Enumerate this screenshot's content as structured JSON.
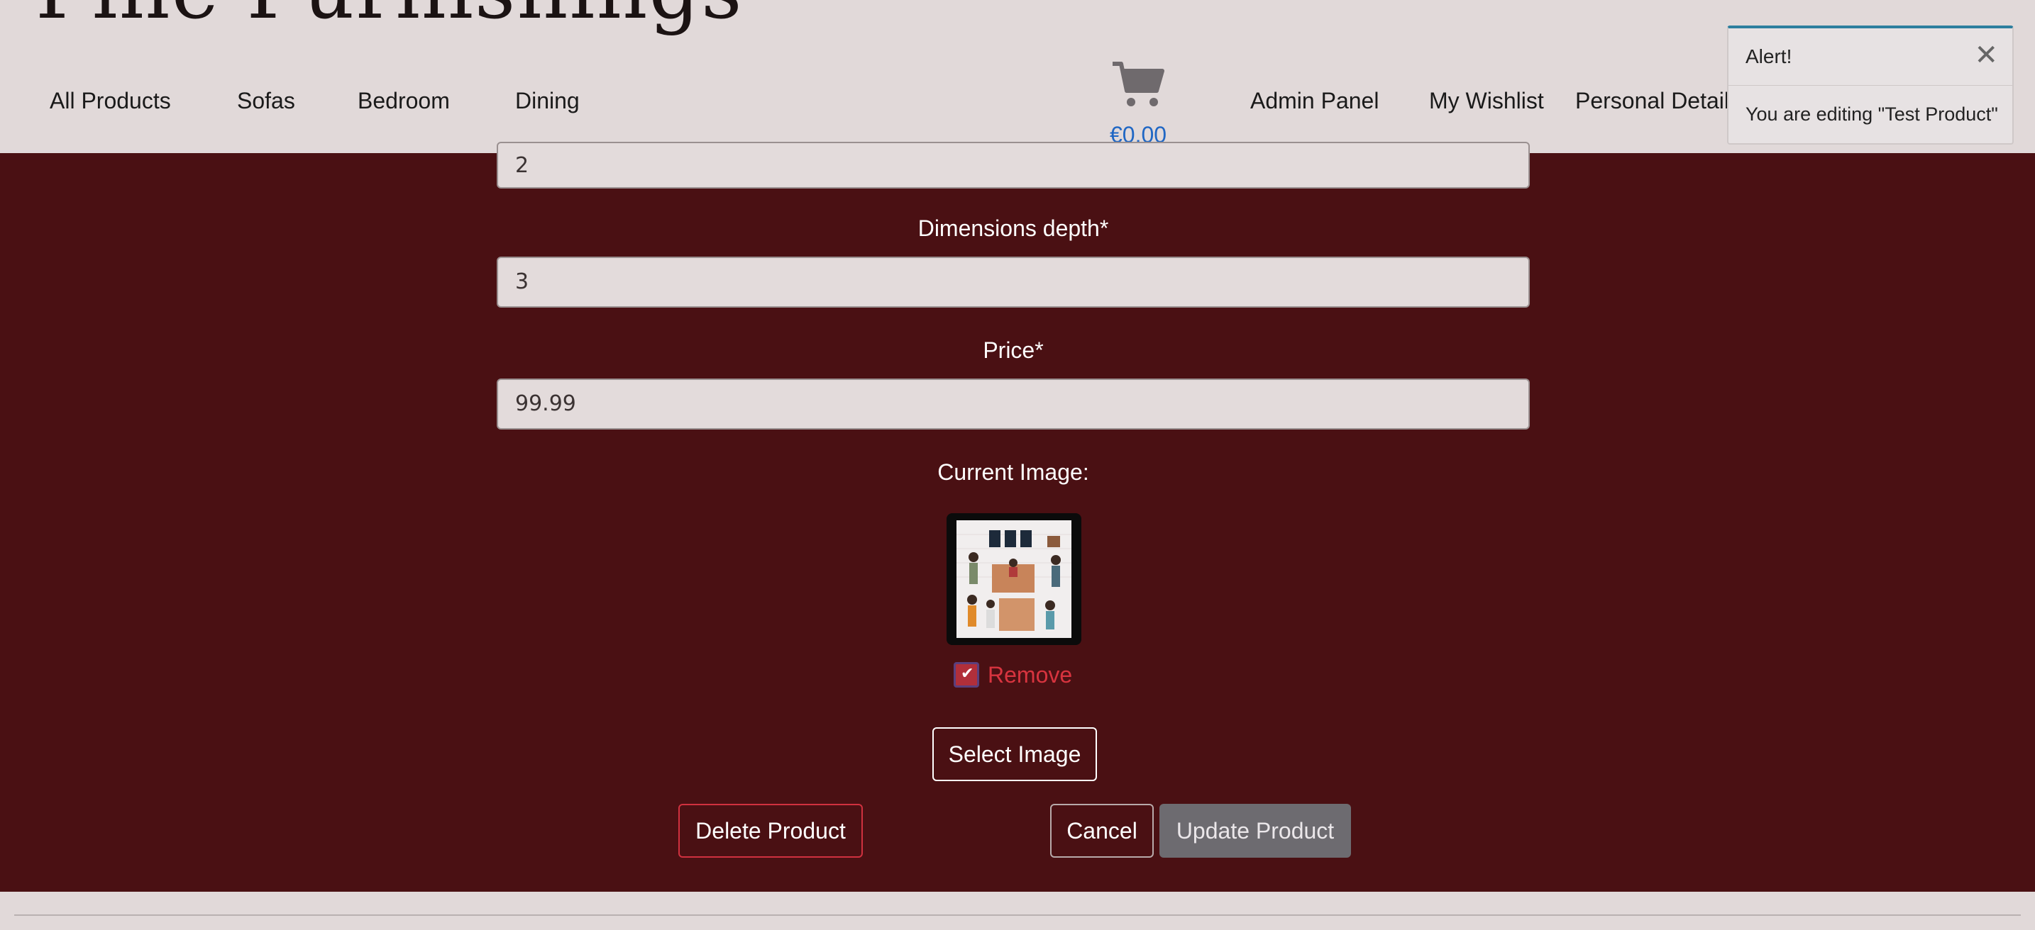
{
  "header": {
    "brand": "Fine Furnishings",
    "nav_left": [
      "All Products",
      "Sofas",
      "Bedroom",
      "Dining"
    ],
    "cart_total": "€0.00",
    "nav_right": [
      "Admin Panel",
      "My Wishlist",
      "Personal Details"
    ]
  },
  "form": {
    "height_value": "2",
    "depth_label": "Dimensions depth*",
    "depth_value": "3",
    "price_label": "Price*",
    "price_value": "99.99",
    "current_image_label": "Current Image:",
    "remove_checked": true,
    "remove_label": "Remove",
    "select_image_label": "Select Image",
    "delete_label": "Delete Product",
    "cancel_label": "Cancel",
    "update_label": "Update Product"
  },
  "toast": {
    "title": "Alert!",
    "close_glyph": "✕",
    "message": "You are editing \"Test Product\""
  },
  "icons": {
    "cart": "shopping-cart-icon",
    "close": "close-icon",
    "check": "check-icon"
  },
  "colors": {
    "header_bg": "#e1d9d9",
    "main_bg": "#4a1013",
    "delete_border": "#d0313f",
    "cart_total": "#2067c4",
    "toast_accent": "#2d7f9e"
  }
}
